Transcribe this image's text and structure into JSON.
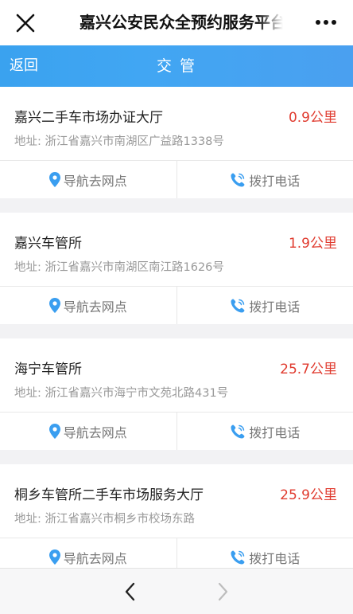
{
  "window": {
    "title": "嘉兴公安民众全预约服务平台"
  },
  "app_header": {
    "back_label": "返回",
    "title": "交 管"
  },
  "colors": {
    "accent_blue": "#41a6f3",
    "distance_red": "#e03b2f",
    "icon_blue": "#3a9ef0"
  },
  "locations": [
    {
      "name": "嘉兴二手车市场办证大厅",
      "distance": "0.9公里",
      "address": "地址: 浙江省嘉兴市南湖区广益路1338号",
      "nav_label": "导航去网点",
      "call_label": "拨打电话"
    },
    {
      "name": "嘉兴车管所",
      "distance": "1.9公里",
      "address": "地址: 浙江省嘉兴市南湖区南江路1626号",
      "nav_label": "导航去网点",
      "call_label": "拨打电话"
    },
    {
      "name": "海宁车管所",
      "distance": "25.7公里",
      "address": "地址: 浙江省嘉兴市海宁市文苑北路431号",
      "nav_label": "导航去网点",
      "call_label": "拨打电话"
    },
    {
      "name": "桐乡车管所二手车市场服务大厅",
      "distance": "25.9公里",
      "address": "地址: 浙江省嘉兴市桐乡市校场东路",
      "nav_label": "导航去网点",
      "call_label": "拨打电话"
    }
  ],
  "icons": {
    "close": "close-icon",
    "more": "more-icon",
    "location": "location-pin-icon",
    "phone": "phone-icon",
    "prev": "chevron-left-icon",
    "next": "chevron-right-icon"
  }
}
